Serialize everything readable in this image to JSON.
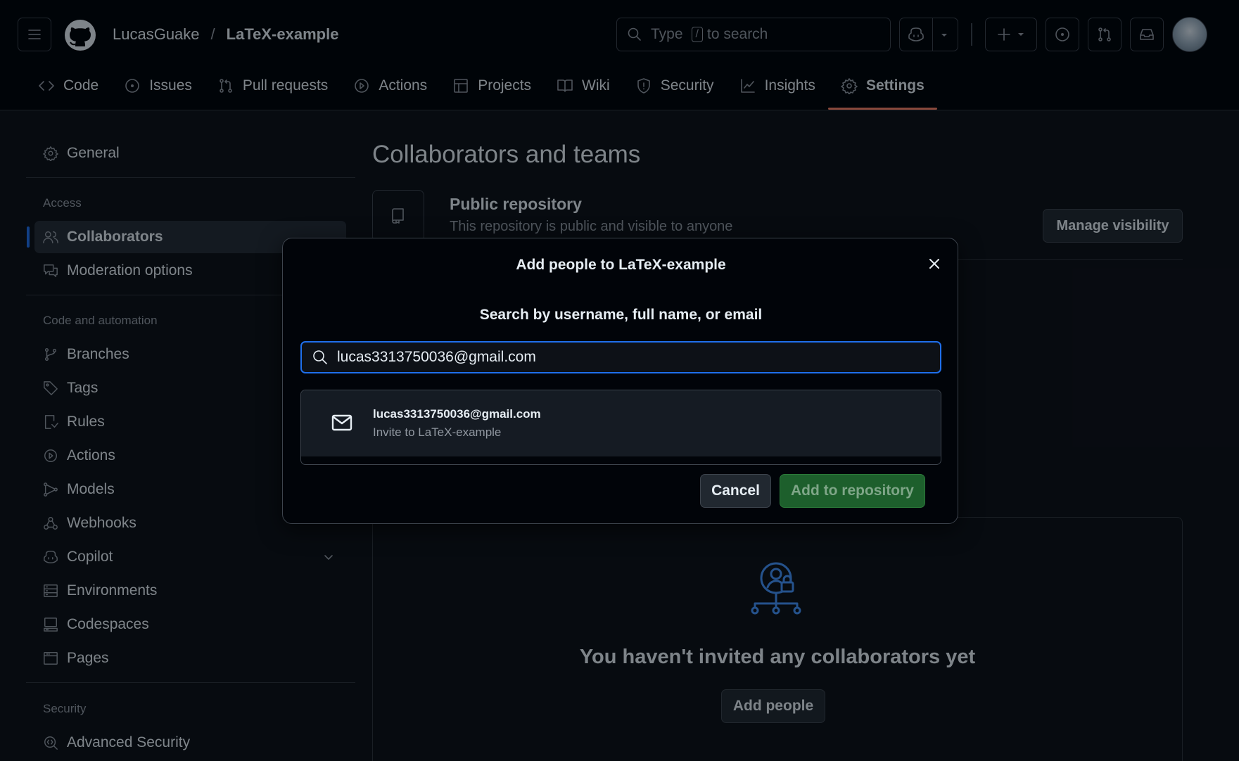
{
  "header": {
    "owner": "LucasGuake",
    "separator": "/",
    "repo": "LaTeX-example",
    "search": {
      "prefix": "Type",
      "key": "/",
      "suffix": "to search"
    },
    "icons": [
      "hamburger-icon",
      "github-logo-icon",
      "search-icon",
      "copilot-icon",
      "chevron-down-icon",
      "plus-icon",
      "issue-opened-icon",
      "git-pull-request-icon",
      "inbox-icon"
    ]
  },
  "tabs": [
    {
      "label": "Code",
      "icon": "code-icon"
    },
    {
      "label": "Issues",
      "icon": "issue-opened-icon"
    },
    {
      "label": "Pull requests",
      "icon": "git-pull-request-icon"
    },
    {
      "label": "Actions",
      "icon": "play-icon"
    },
    {
      "label": "Projects",
      "icon": "table-icon"
    },
    {
      "label": "Wiki",
      "icon": "book-icon"
    },
    {
      "label": "Security",
      "icon": "shield-icon"
    },
    {
      "label": "Insights",
      "icon": "graph-icon"
    },
    {
      "label": "Settings",
      "icon": "gear-icon",
      "active": true
    }
  ],
  "sidebar": {
    "general": "General",
    "access_heading": "Access",
    "collaborators": "Collaborators",
    "moderation": "Moderation options",
    "code_heading": "Code and automation",
    "branches": "Branches",
    "tags": "Tags",
    "rules": "Rules",
    "actions": "Actions",
    "models": "Models",
    "webhooks": "Webhooks",
    "copilot": "Copilot",
    "environments": "Environments",
    "codespaces": "Codespaces",
    "pages": "Pages",
    "security_heading": "Security",
    "advanced_security": "Advanced Security"
  },
  "main": {
    "title": "Collaborators and teams",
    "public_title": "Public repository",
    "public_desc": "This repository is public and visible to anyone",
    "manage_visibility": "Manage visibility",
    "empty_text": "You haven't invited any collaborators yet",
    "add_people": "Add people"
  },
  "dialog": {
    "title": "Add people to LaTeX-example",
    "subtitle": "Search by username, full name, or email",
    "search_value": "lucas3313750036@gmail.com",
    "result_email": "lucas3313750036@gmail.com",
    "result_invite": "Invite to LaTeX-example",
    "cancel": "Cancel",
    "add": "Add to repository"
  },
  "colors": {
    "background": "#0d1117",
    "header_bg": "#010409",
    "accent_blue": "#1f6feb",
    "tab_underline": "#f78166",
    "primary_green": "#1d5f2c",
    "muted_text": "#9198a1"
  }
}
